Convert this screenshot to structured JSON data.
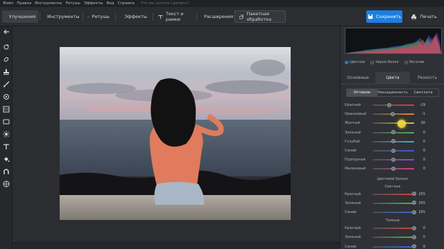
{
  "menu": {
    "items": [
      "Файл",
      "Правка",
      "Инструменты",
      "Ретушь",
      "Эффекты",
      "Вид",
      "Справка"
    ],
    "search_placeholder": "Что вы хотите сделать?"
  },
  "toolbar": {
    "enhance": "Улучшения",
    "tools": "Инструменты",
    "retouch": "Ретушь",
    "effects": "Эффекты",
    "text_frames": "Текст и рамки",
    "extensions": "Расширения",
    "batch": "Пакетная обработка",
    "save": "Сохранить",
    "print": "Печать"
  },
  "panel": {
    "hist_modes": [
      "Цветное",
      "Черно-белое",
      "Негатив"
    ],
    "tabs": [
      "Основные",
      "Цвета",
      "Резкость"
    ],
    "active_tab": "Цвета",
    "subtabs": [
      "Оттенок",
      "Насыщенность",
      "Светлота"
    ],
    "active_subtab": "Оттенок",
    "sliders": [
      {
        "label": "Красный",
        "value": "-19",
        "pos": 0.4,
        "color": "#d9433a"
      },
      {
        "label": "Оранжевый",
        "value": "-1",
        "pos": 0.49,
        "color": "#e48a2a"
      },
      {
        "label": "Желтый",
        "value": "30",
        "pos": 0.65,
        "color": "#d8c93a"
      },
      {
        "label": "Зеленый",
        "value": "0",
        "pos": 0.5,
        "color": "#4fb548"
      },
      {
        "label": "Голубой",
        "value": "0",
        "pos": 0.5,
        "color": "#41b8c9"
      },
      {
        "label": "Синий",
        "value": "0",
        "pos": 0.5,
        "color": "#3e63d8"
      },
      {
        "label": "Пурпурный",
        "value": "0",
        "pos": 0.5,
        "color": "#9a49d4"
      },
      {
        "label": "Малиновый",
        "value": "0",
        "pos": 0.5,
        "color": "#d5419a"
      }
    ],
    "balance_title": "Цветовой баланс",
    "lights_title": "Светлые",
    "lights": [
      {
        "label": "Красный",
        "value": "255",
        "pos": 1.0,
        "color": "#d9433a"
      },
      {
        "label": "Зеленый",
        "value": "255",
        "pos": 1.0,
        "color": "#4fb548"
      },
      {
        "label": "Синий",
        "value": "255",
        "pos": 1.0,
        "color": "#3e63d8"
      }
    ],
    "shadows_title": "Темные",
    "shadows": [
      {
        "label": "Красный",
        "value": "0",
        "pos": 1.0,
        "color": "#d9433a"
      },
      {
        "label": "Зеленый",
        "value": "0",
        "pos": 1.0,
        "color": "#4fb548"
      },
      {
        "label": "Синий",
        "value": "0",
        "pos": 1.0,
        "color": "#3e63d8"
      }
    ]
  },
  "colors": {
    "accent": "#1b7fe0",
    "bg": "#2b2d31",
    "panel": "#2f3136"
  }
}
